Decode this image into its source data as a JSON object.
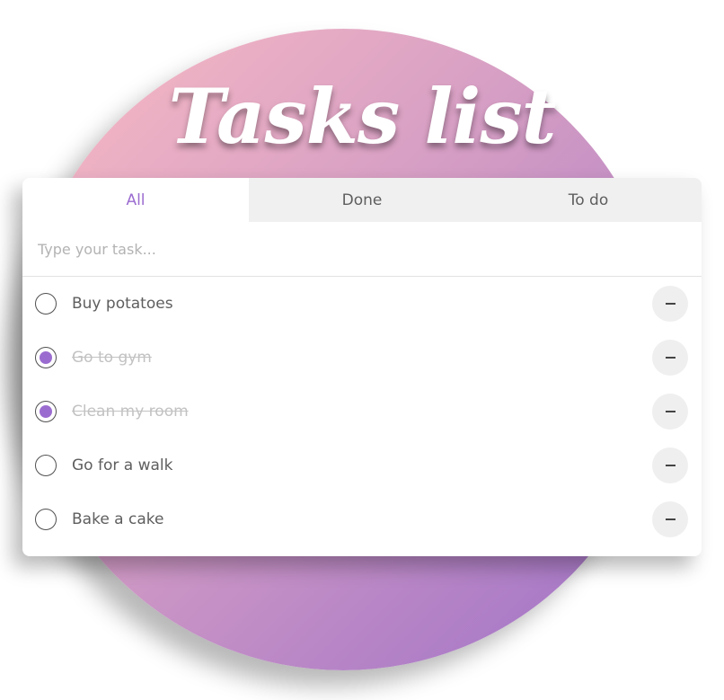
{
  "title": "Tasks list",
  "tabs": [
    {
      "label": "All",
      "active": true
    },
    {
      "label": "Done",
      "active": false
    },
    {
      "label": "To do",
      "active": false
    }
  ],
  "input": {
    "placeholder": "Type your task...",
    "value": ""
  },
  "tasks": [
    {
      "text": "Buy potatoes",
      "done": false
    },
    {
      "text": "Go to gym",
      "done": true
    },
    {
      "text": "Clean my room",
      "done": true
    },
    {
      "text": "Go for a walk",
      "done": false
    },
    {
      "text": "Bake a cake",
      "done": false
    }
  ],
  "icons": {
    "checkbox": "radio-circle-icon",
    "delete": "minus-icon"
  },
  "colors": {
    "accent": "#9b6cd0",
    "gradient_start": "#fbbcc3",
    "gradient_end": "#9d70c8",
    "done_text": "#c2c2c2"
  }
}
